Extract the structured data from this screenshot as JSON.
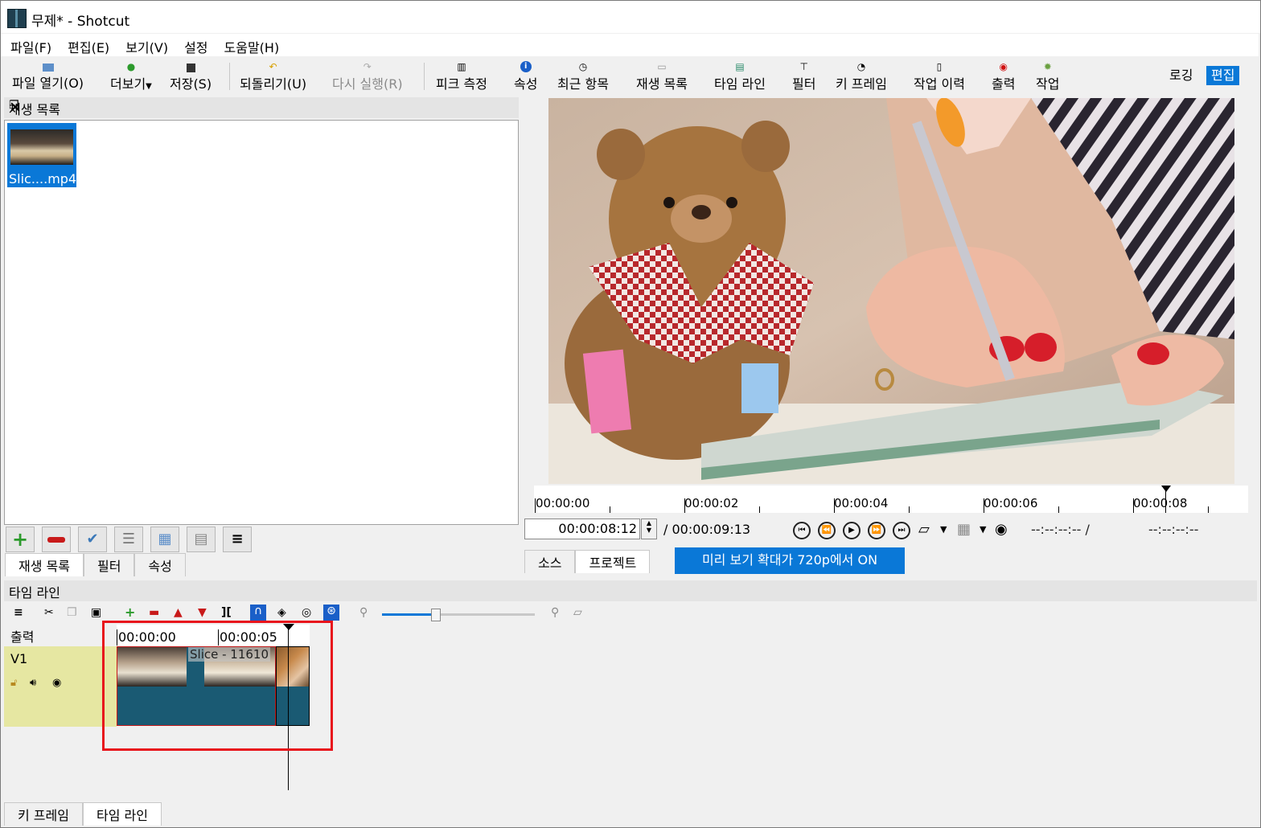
{
  "window": {
    "title": "무제* - Shotcut"
  },
  "menu": [
    "파일(F)",
    "편집(E)",
    "보기(V)",
    "설정",
    "도움말(H)"
  ],
  "toolbar": {
    "open": "파일 열기(O)",
    "more": "더보기",
    "save": "저장(S)",
    "undo": "되돌리기(U)",
    "redo": "다시 실행(R)",
    "peak": "피크 측정",
    "properties": "속성",
    "recent": "최근 항목",
    "playlist": "재생 목록",
    "timeline": "타임 라인",
    "filters": "필터",
    "keyframes": "키 프레임",
    "history": "작업 이력",
    "export": "출력",
    "jobs": "작업",
    "mode_logging": "로깅",
    "mode_editing": "편집"
  },
  "playlist": {
    "title": "재생 목록",
    "items": [
      {
        "label": "Slic....mp4"
      }
    ],
    "tabs": [
      "재생 목록",
      "필터",
      "속성"
    ]
  },
  "player": {
    "ruler_labels": [
      "00:00:00",
      "00:00:02",
      "00:00:04",
      "00:00:06",
      "00:00:08"
    ],
    "position": "00:00:08:12",
    "duration": "/ 00:00:09:13",
    "in_point": "--:--:--:-- /",
    "out_point": "--:--:--:--",
    "tabs": [
      "소스",
      "프로젝트"
    ],
    "preview_scaling_note": "미리 보기 확대가 720p에서 ON"
  },
  "timeline": {
    "title": "타임 라인",
    "output_label": "출력",
    "track_name": "V1",
    "ruler_labels": [
      "00:00:00",
      "00:00:05"
    ],
    "clip_label": "Slice - 11610",
    "zoom_level": 0.35
  },
  "bottom_tabs": [
    "키 프레임",
    "타임 라인"
  ],
  "colors": {
    "accent": "#0a78d7",
    "track_header": "#e6e7a2",
    "clip": "#1a5a73",
    "highlight_box": "#e8141c"
  }
}
